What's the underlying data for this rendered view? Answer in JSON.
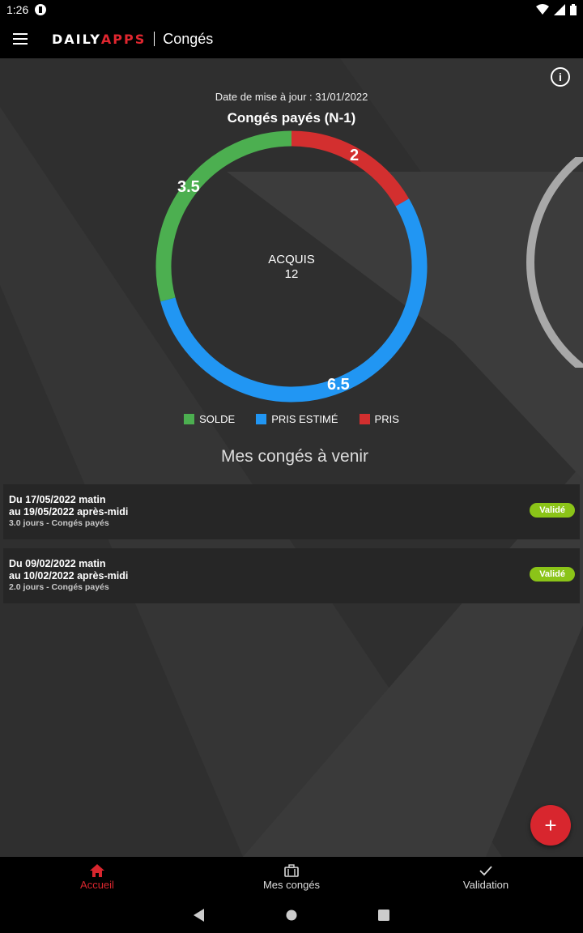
{
  "status_bar": {
    "time": "1:26"
  },
  "app_bar": {
    "logo_white": "DAILY",
    "logo_red": "APPS",
    "title": "Congés"
  },
  "summary": {
    "update_date": "Date de mise à jour : 31/01/2022",
    "title": "Congés payés (N-1)",
    "center_label": "ACQUIS",
    "center_value": "12"
  },
  "chart_data": {
    "type": "pie",
    "center_label": "ACQUIS",
    "center_value": 12,
    "series": [
      {
        "name": "SOLDE",
        "value": 3.5,
        "label": "3.5",
        "color": "#4caf50"
      },
      {
        "name": "PRIS ESTIMÉ",
        "value": 6.5,
        "label": "6.5",
        "color": "#2196f3"
      },
      {
        "name": "PRIS",
        "value": 2,
        "label": "2",
        "color": "#d32f2f"
      }
    ],
    "legend": [
      "SOLDE",
      "PRIS ESTIMÉ",
      "PRIS"
    ]
  },
  "upcoming": {
    "title": "Mes congés à venir",
    "items": [
      {
        "line1": "Du 17/05/2022 matin",
        "line2": "au 19/05/2022 après-midi",
        "line3": "3.0 jours - Congés payés",
        "status": "Validé"
      },
      {
        "line1": "Du 09/02/2022 matin",
        "line2": "au 10/02/2022 après-midi",
        "line3": "2.0 jours - Congés payés",
        "status": "Validé"
      }
    ]
  },
  "bottom_nav": {
    "home": "Accueil",
    "my_leaves": "Mes congés",
    "validation": "Validation"
  },
  "colors": {
    "accent": "#d8262e",
    "badge": "#8bc418",
    "background": "#2f2f2f"
  }
}
